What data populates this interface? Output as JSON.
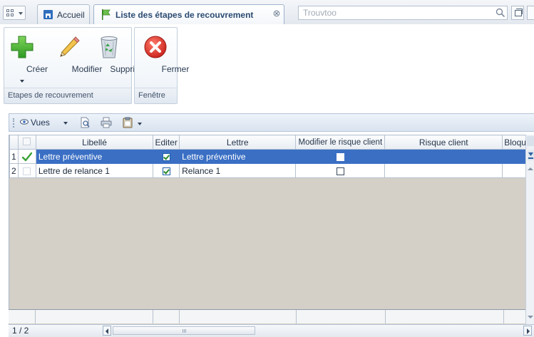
{
  "tabs": {
    "home_label": "Accueil",
    "active_label": "Liste des étapes de recouvrement"
  },
  "search": {
    "placeholder": "Trouvtoo"
  },
  "ribbon": {
    "groups": [
      {
        "label": "Etapes de recouvrement",
        "buttons": [
          {
            "label": "Créer",
            "icon": "plus-icon"
          },
          {
            "label": "Modifier",
            "icon": "pencil-icon"
          },
          {
            "label": "Supprimer",
            "icon": "recycle-bin-icon"
          }
        ]
      },
      {
        "label": "Fenêtre",
        "buttons": [
          {
            "label": "Fermer",
            "icon": "close-circle-icon"
          }
        ]
      }
    ]
  },
  "grid_toolbar": {
    "views_label": "Vues"
  },
  "grid": {
    "columns": [
      "Libellé",
      "Editer",
      "Lettre",
      "Modifier le risque client",
      "Risque client",
      "Bloqu"
    ],
    "rows": [
      {
        "num": "1",
        "libelle": "Lettre préventive",
        "editer": true,
        "lettre": "Lettre préventive",
        "modifier_risque": false,
        "risque": "",
        "selected": true,
        "current": true
      },
      {
        "num": "2",
        "libelle": "Lettre de relance 1",
        "editer": true,
        "lettre": "Relance 1",
        "modifier_risque": false,
        "risque": "",
        "selected": false,
        "current": false
      }
    ]
  },
  "pager": {
    "text": "1 / 2"
  },
  "colors": {
    "selection": "#3a6fc4",
    "accent": "#2f6fbd",
    "grid_background": "#d4d0c8"
  }
}
